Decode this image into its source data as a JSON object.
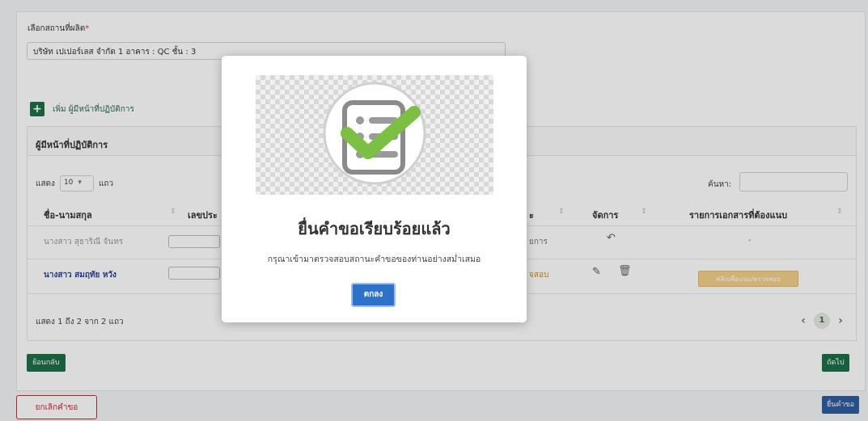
{
  "form": {
    "location_label": "เลือกสถานที่ผลิต",
    "required_mark": "*",
    "location_value": "บริษัท เปเปอร์เลส จำกัด 1 อาคาร : QC ชั้น : 3",
    "add_operator_label": "เพิ่ม ผู้มีหน้าที่ปฏิบัติการ"
  },
  "operators_table": {
    "title": "ผู้มีหน้าที่ปฏิบัติการ",
    "show_prefix": "แสดง",
    "page_length": "10",
    "show_suffix": "แถว",
    "search_label": "ค้นหา:",
    "columns": [
      "ชื่อ-นามสกุล",
      "เลขประ",
      "ะ",
      "จัดการ",
      "รายการเอกสารที่ต้องแนบ"
    ],
    "rows": [
      {
        "name": "นางสาว สุธาริณี จันทร",
        "status": "ยการ",
        "document": "-"
      },
      {
        "name": "นางสาว สมฤทัย หวัง",
        "status": "จสอบ",
        "document_button": "คลิกเพื่อแนบ/ตรวจสอบ"
      }
    ],
    "info": "แสดง 1 ถึง 2 จาก 2 แถว",
    "current_page": "1"
  },
  "buttons": {
    "back": "ย้อนกลับ",
    "next": "ถัดไป",
    "cancel_request": "ยกเลิกคำขอ",
    "submit_request": "ยื่นคำขอ"
  },
  "modal": {
    "title": "ยื่นคำขอเรียบร้อยแล้ว",
    "message": "กรุณาเข้ามาตรวจสอบสถานะคำขอของท่านอย่างสม่ำเสมอ",
    "ok_label": "ตกลง"
  },
  "colors": {
    "primary_green": "#1f6f47",
    "modal_button_blue": "#2e71c9",
    "check_green": "#7bc043",
    "cancel_red": "#c92c2c",
    "document_button": "#f3d08a",
    "status_orange": "#d18a17"
  }
}
